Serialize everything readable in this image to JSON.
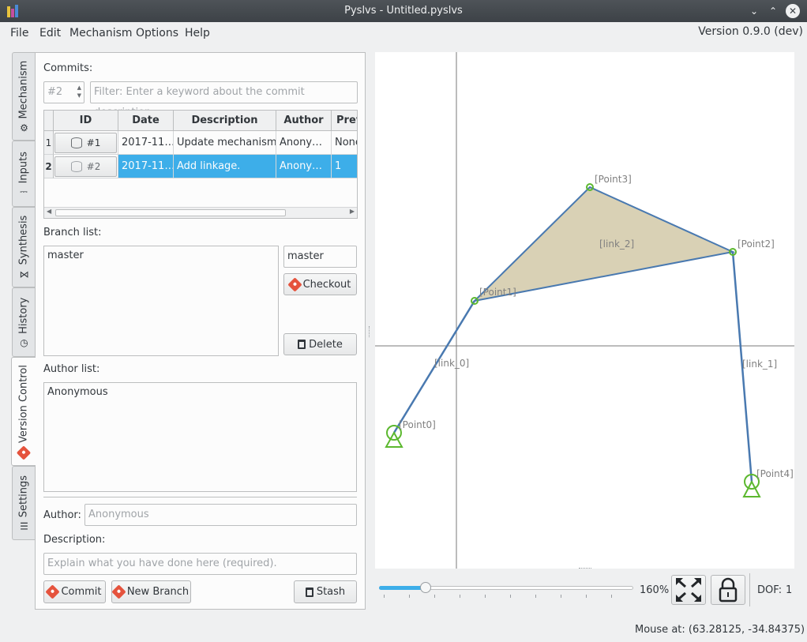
{
  "window": {
    "title": "Pyslvs - Untitled.pyslvs"
  },
  "menu": {
    "items": [
      "File",
      "Edit",
      "Mechanism",
      "Options",
      "Help"
    ],
    "version": "Version 0.9.0 (dev)"
  },
  "tabs": [
    "Mechanism",
    "Inputs",
    "Synthesis",
    "History",
    "Version Control",
    "Settings"
  ],
  "commits": {
    "label": "Commits:",
    "spin_value": "#2",
    "filter_placeholder": "Filter: Enter a keyword about the commit description.",
    "columns": [
      "ID",
      "Date",
      "Description",
      "Author",
      "Previ"
    ],
    "rows": [
      {
        "num": "1",
        "id": "#1",
        "date": "2017-11…",
        "description": "Update mechanism.",
        "author": "Anony…",
        "previous": "None"
      },
      {
        "num": "2",
        "id": "#2",
        "date": "2017-11…",
        "description": "Add linkage.",
        "author": "Anony…",
        "previous": "1"
      }
    ]
  },
  "branch": {
    "label": "Branch list:",
    "items": [
      "master"
    ],
    "current": "master",
    "checkout": "Checkout",
    "delete": "Delete"
  },
  "authors": {
    "label": "Author list:",
    "items": [
      "Anonymous"
    ]
  },
  "form": {
    "author_label": "Author:",
    "author_placeholder": "Anonymous",
    "description_label": "Description:",
    "description_placeholder": "Explain what you have done here (required).",
    "commit": "Commit",
    "new_branch": "New Branch",
    "stash": "Stash"
  },
  "canvas": {
    "points": [
      "[Point0]",
      "[Point1]",
      "[Point2]",
      "[Point3]",
      "[Point4]"
    ],
    "links": [
      "[link_0]",
      "[link_1]",
      "[link_2]"
    ],
    "colors": {
      "link": "#4979b0",
      "fill": "#d9d1b5",
      "point": "#5cb82f",
      "axis": "#7a7a7a",
      "label": "#808080"
    }
  },
  "zoom": {
    "value_text": "160%",
    "level_fraction": 0.17
  },
  "dof": {
    "label": "DOF:",
    "value": "1"
  },
  "status": {
    "mouse": "Mouse at: (63.28125, -34.84375)"
  }
}
